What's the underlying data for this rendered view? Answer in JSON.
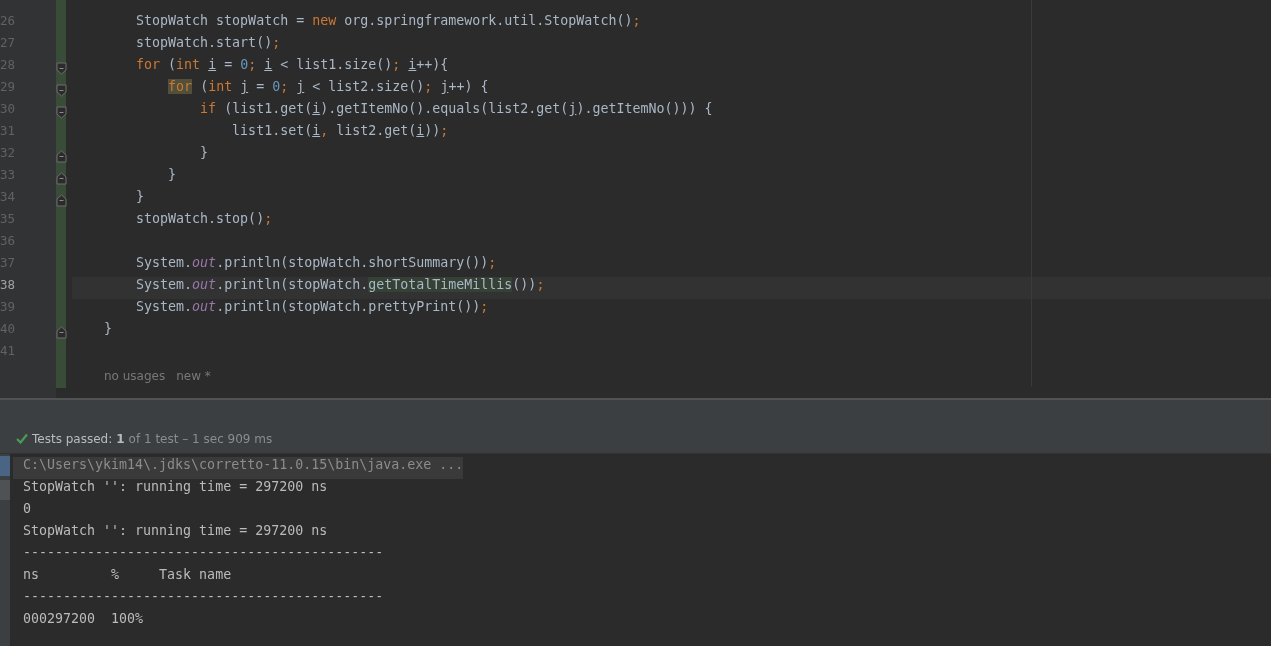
{
  "editor": {
    "lines": [
      {
        "number": "26",
        "current": false,
        "fold_open": false,
        "fold_close": false,
        "segments": [
          {
            "text": "        StopWatch stopWatch = ",
            "kind": "plain"
          },
          {
            "text": "new ",
            "kind": "keyword"
          },
          {
            "text": "org.springframework.util.StopWatch()",
            "kind": "plain"
          },
          {
            "text": ";",
            "kind": "keyword"
          }
        ]
      },
      {
        "number": "27",
        "current": false,
        "fold_open": false,
        "fold_close": false,
        "segments": [
          {
            "text": "        stopWatch.start()",
            "kind": "plain"
          },
          {
            "text": ";",
            "kind": "keyword"
          }
        ]
      },
      {
        "number": "28",
        "current": false,
        "fold_open": true,
        "fold_close": false,
        "segments": [
          {
            "text": "        for ",
            "kind": "keyword"
          },
          {
            "text": "(",
            "kind": "plain"
          },
          {
            "text": "int ",
            "kind": "keyword"
          },
          {
            "text": "i",
            "kind": "variable"
          },
          {
            "text": " = ",
            "kind": "plain"
          },
          {
            "text": "0",
            "kind": "number"
          },
          {
            "text": "; ",
            "kind": "keyword"
          },
          {
            "text": "i",
            "kind": "variable"
          },
          {
            "text": " < list1.size()",
            "kind": "plain"
          },
          {
            "text": "; ",
            "kind": "keyword"
          },
          {
            "text": "i",
            "kind": "variable"
          },
          {
            "text": "++){",
            "kind": "plain"
          }
        ]
      },
      {
        "number": "29",
        "current": false,
        "fold_open": true,
        "fold_close": false,
        "segments": [
          {
            "text": "            for",
            "kind": "keyword-match"
          },
          {
            "text": " (",
            "kind": "plain"
          },
          {
            "text": "int ",
            "kind": "keyword"
          },
          {
            "text": "j",
            "kind": "variable"
          },
          {
            "text": " = ",
            "kind": "plain"
          },
          {
            "text": "0",
            "kind": "number"
          },
          {
            "text": "; ",
            "kind": "keyword"
          },
          {
            "text": "j",
            "kind": "variable"
          },
          {
            "text": " < list2.size()",
            "kind": "plain"
          },
          {
            "text": "; ",
            "kind": "keyword"
          },
          {
            "text": "j",
            "kind": "variable"
          },
          {
            "text": "++) {",
            "kind": "plain"
          }
        ]
      },
      {
        "number": "30",
        "current": false,
        "fold_open": true,
        "fold_close": false,
        "segments": [
          {
            "text": "                if ",
            "kind": "keyword"
          },
          {
            "text": "(list1.get(",
            "kind": "plain"
          },
          {
            "text": "i",
            "kind": "variable"
          },
          {
            "text": ").getItemNo().equals(list2.get(",
            "kind": "plain"
          },
          {
            "text": "j",
            "kind": "variable"
          },
          {
            "text": ").getItemNo())) {",
            "kind": "plain"
          }
        ]
      },
      {
        "number": "31",
        "current": false,
        "fold_open": false,
        "fold_close": false,
        "segments": [
          {
            "text": "                    list1.set(",
            "kind": "plain"
          },
          {
            "text": "i",
            "kind": "variable"
          },
          {
            "text": ", ",
            "kind": "keyword"
          },
          {
            "text": "list2.get(",
            "kind": "plain"
          },
          {
            "text": "i",
            "kind": "variable"
          },
          {
            "text": "))",
            "kind": "plain"
          },
          {
            "text": ";",
            "kind": "keyword"
          }
        ]
      },
      {
        "number": "32",
        "current": false,
        "fold_open": false,
        "fold_close": true,
        "segments": [
          {
            "text": "                }",
            "kind": "plain"
          }
        ]
      },
      {
        "number": "33",
        "current": false,
        "fold_open": false,
        "fold_close": true,
        "segments": [
          {
            "text": "            }",
            "kind": "plain"
          }
        ]
      },
      {
        "number": "34",
        "current": false,
        "fold_open": false,
        "fold_close": true,
        "segments": [
          {
            "text": "        }",
            "kind": "plain"
          }
        ]
      },
      {
        "number": "35",
        "current": false,
        "fold_open": false,
        "fold_close": false,
        "segments": [
          {
            "text": "        stopWatch.stop()",
            "kind": "plain"
          },
          {
            "text": ";",
            "kind": "keyword"
          }
        ]
      },
      {
        "number": "36",
        "current": false,
        "fold_open": false,
        "fold_close": false
      },
      {
        "number": "37",
        "current": false,
        "fold_open": false,
        "fold_close": false,
        "segments": [
          {
            "text": "        System.",
            "kind": "plain"
          },
          {
            "text": "out",
            "kind": "field"
          },
          {
            "text": ".println(stopWatch.shortSummary())",
            "kind": "plain"
          },
          {
            "text": ";",
            "kind": "keyword"
          }
        ]
      },
      {
        "number": "38",
        "current": true,
        "fold_open": false,
        "fold_close": false,
        "segments": [
          {
            "text": "        System.",
            "kind": "plain"
          },
          {
            "text": "out",
            "kind": "field"
          },
          {
            "text": ".println(stopWatch.",
            "kind": "plain"
          },
          {
            "text": "getTotalTimeMillis",
            "kind": "method-match"
          },
          {
            "text": "())",
            "kind": "plain"
          },
          {
            "text": ";",
            "kind": "keyword"
          }
        ]
      },
      {
        "number": "39",
        "current": false,
        "fold_open": false,
        "fold_close": false,
        "segments": [
          {
            "text": "        System.",
            "kind": "plain"
          },
          {
            "text": "out",
            "kind": "field"
          },
          {
            "text": ".println(stopWatch.prettyPrint())",
            "kind": "plain"
          },
          {
            "text": ";",
            "kind": "keyword"
          }
        ]
      },
      {
        "number": "40",
        "current": false,
        "fold_open": false,
        "fold_close": true,
        "segments": [
          {
            "text": "    }",
            "kind": "plain"
          }
        ]
      },
      {
        "number": "41",
        "current": false,
        "fold_open": false,
        "fold_close": false
      }
    ],
    "inlay_hints": [
      "no usages",
      "new *"
    ]
  },
  "test_status": {
    "passed": true,
    "label": "Tests passed:",
    "count": "1",
    "detail": "of 1 test – 1 sec 909 ms"
  },
  "console": {
    "lines": [
      {
        "text": "C:\\Users\\ykim14\\.jdks\\corretto-11.0.15\\bin\\java.exe ...",
        "kind": "command"
      },
      {
        "text": "StopWatch '': running time = 297200 ns",
        "kind": "output"
      },
      {
        "text": "0",
        "kind": "output"
      },
      {
        "text": "StopWatch '': running time = 297200 ns",
        "kind": "output"
      },
      {
        "text": "---------------------------------------------",
        "kind": "output"
      },
      {
        "text": "ns         %     Task name",
        "kind": "output"
      },
      {
        "text": "---------------------------------------------",
        "kind": "output"
      },
      {
        "text": "000297200  100%",
        "kind": "output"
      }
    ]
  }
}
